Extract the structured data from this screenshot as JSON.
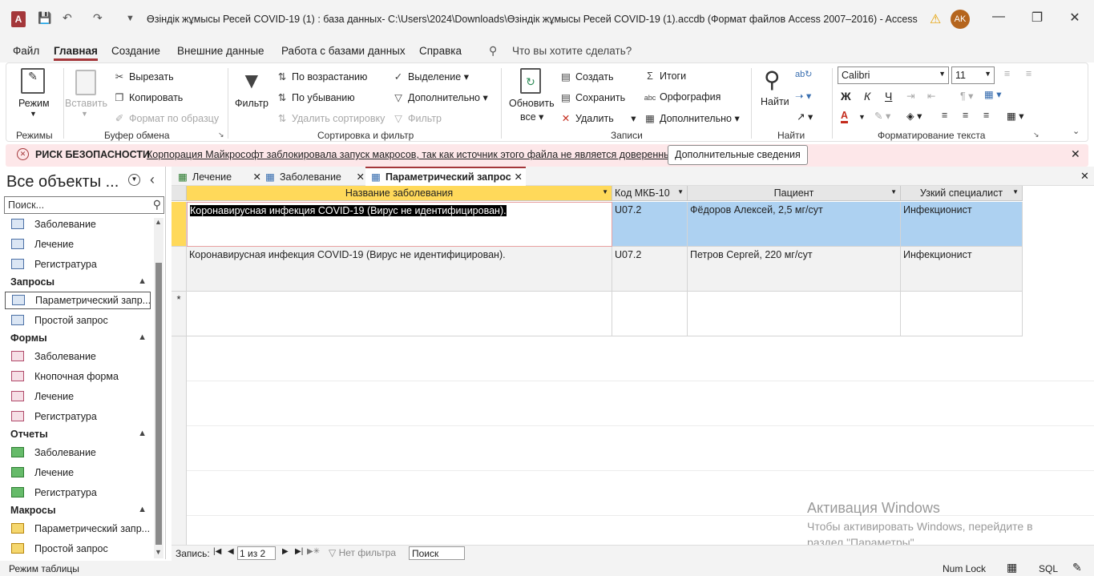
{
  "titlebar": {
    "title": "Өзіндік жұмысы Ресей COVID-19 (1) : база данных- C:\\Users\\2024\\Downloads\\Өзіндік жұмысы Ресей COVID-19 (1).accdb (Формат файлов Access 2007–2016)  -  Access",
    "user_initials": "AK"
  },
  "menu": {
    "file": "Файл",
    "home": "Главная",
    "create": "Создание",
    "external": "Внешние данные",
    "dbtools": "Работа с базами данных",
    "help": "Справка",
    "search": "Что вы хотите сделать?"
  },
  "ribbon": {
    "views": {
      "view": "Режим",
      "group": "Режимы"
    },
    "clipboard": {
      "paste": "Вставить",
      "cut": "Вырезать",
      "copy": "Копировать",
      "format_painter": "Формат по образцу",
      "group": "Буфер обмена"
    },
    "sort": {
      "filter": "Фильтр",
      "asc": "По возрастанию",
      "desc": "По убыванию",
      "remove_sort": "Удалить сортировку",
      "selection": "Выделение",
      "advanced": "Дополнительно",
      "toggle_filter": "Фильтр",
      "group": "Сортировка и фильтр"
    },
    "records": {
      "refresh1": "Обновить",
      "refresh2": "все",
      "new": "Создать",
      "save": "Сохранить",
      "delete": "Удалить",
      "totals": "Итоги",
      "spelling": "Орфография",
      "more": "Дополнительно",
      "group": "Записи"
    },
    "find": {
      "find": "Найти",
      "group": "Найти"
    },
    "text": {
      "font": "Calibri",
      "size": "11",
      "bold": "Ж",
      "italic": "К",
      "underline": "Ч",
      "group": "Форматирование текста"
    }
  },
  "security": {
    "title": "РИСК БЕЗОПАСНОСТИ",
    "message": "Корпорация Майкрософт заблокировала запуск макросов, так как источник этого файла не является доверенным.",
    "button": "Дополнительные сведения"
  },
  "nav": {
    "title": "Все объекты ...",
    "search_placeholder": "Поиск...",
    "tables": [
      "Заболевание",
      "Лечение",
      "Регистратура"
    ],
    "queries_header": "Запросы",
    "queries": [
      "Параметрический запр...",
      "Простой запрос"
    ],
    "forms_header": "Формы",
    "forms": [
      "Заболевание",
      "Кнопочная форма",
      "Лечение",
      "Регистратура"
    ],
    "reports_header": "Отчеты",
    "reports": [
      "Заболевание",
      "Лечение",
      "Регистратура"
    ],
    "macros_header": "Макросы",
    "macros": [
      "Параметрический запр...",
      "Простой запрос"
    ]
  },
  "tabs": [
    "Лечение",
    "Заболевание",
    "Параметрический запрос"
  ],
  "grid": {
    "columns": [
      "Название заболевания",
      "Код МКБ-10",
      "Пациент",
      "Узкий специалист"
    ],
    "rows": [
      [
        "Коронавирусная инфекция COVID-19 (Вирус не идентифицирован).",
        "U07.2",
        "Фёдоров Алексей, 2,5 мг/сут",
        "Инфекционист"
      ],
      [
        "Коронавирусная инфекция COVID-19 (Вирус не идентифицирован).",
        "U07.2",
        "Петров Сергей, 220 мг/сут",
        "Инфекционист"
      ]
    ],
    "new_row_marker": "*"
  },
  "recnav": {
    "label": "Запись:",
    "position": "1 из 2",
    "no_filter": "Нет фильтра",
    "search": "Поиск"
  },
  "status": {
    "mode": "Режим таблицы",
    "numlock": "Num Lock",
    "sql": "SQL"
  },
  "watermark": {
    "line1": "Активация Windows",
    "line2": "Чтобы активировать Windows, перейдите в",
    "line3": "раздел \"Параметры\"."
  }
}
